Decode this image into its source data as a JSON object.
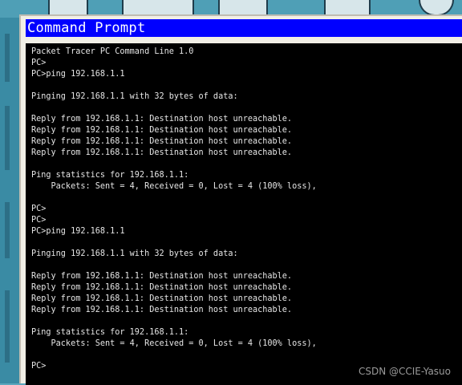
{
  "window": {
    "title": "Command Prompt"
  },
  "console": {
    "lines": [
      "Packet Tracer PC Command Line 1.0",
      "PC>",
      "PC>ping 192.168.1.1",
      "",
      "Pinging 192.168.1.1 with 32 bytes of data:",
      "",
      "Reply from 192.168.1.1: Destination host unreachable.",
      "Reply from 192.168.1.1: Destination host unreachable.",
      "Reply from 192.168.1.1: Destination host unreachable.",
      "Reply from 192.168.1.1: Destination host unreachable.",
      "",
      "Ping statistics for 192.168.1.1:",
      "    Packets: Sent = 4, Received = 0, Lost = 4 (100% loss),",
      "",
      "PC>",
      "PC>",
      "PC>ping 192.168.1.1",
      "",
      "Pinging 192.168.1.1 with 32 bytes of data:",
      "",
      "Reply from 192.168.1.1: Destination host unreachable.",
      "Reply from 192.168.1.1: Destination host unreachable.",
      "Reply from 192.168.1.1: Destination host unreachable.",
      "Reply from 192.168.1.1: Destination host unreachable.",
      "",
      "Ping statistics for 192.168.1.1:",
      "    Packets: Sent = 4, Received = 0, Lost = 4 (100% loss),",
      "",
      "PC>"
    ]
  },
  "watermark": "CSDN @CCIE-Yasuo",
  "colors": {
    "titlebar": "#0000ff",
    "console_bg": "#000000",
    "console_text": "#e6e6e6"
  }
}
